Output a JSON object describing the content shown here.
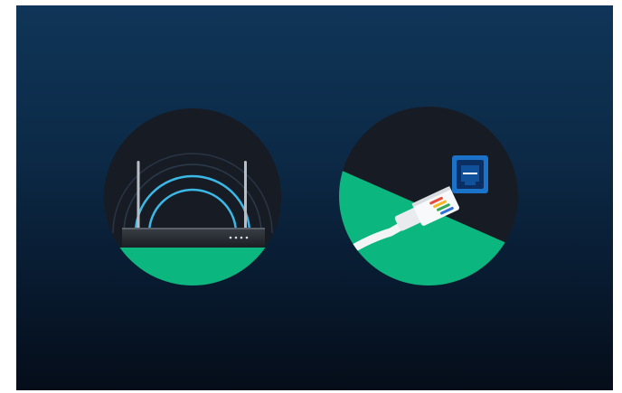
{
  "colors": {
    "background_top": "#0f3558",
    "background_bottom": "#050d19",
    "circle_dark": "#171c24",
    "green": "#0cb67f",
    "wifi_blue": "#3bb8e6",
    "port_blue": "#1a73c9",
    "cable_white": "#f3f4f6"
  },
  "illustrations": [
    {
      "name": "router",
      "icon": "wifi-router-icon"
    },
    {
      "name": "ethernet",
      "icon": "ethernet-cable-icon"
    }
  ],
  "plug_wire_colors": [
    "#e94b3c",
    "#f6b820",
    "#34a853",
    "#2f6fdc"
  ]
}
